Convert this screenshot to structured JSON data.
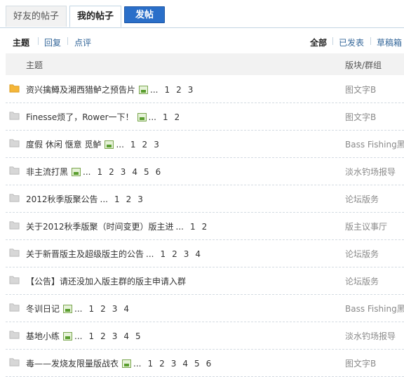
{
  "tabs": {
    "friends_label": "好友的帖子",
    "mine_label": "我的帖子",
    "post_label": "发帖"
  },
  "filters": {
    "subject": "主题",
    "reply": "回复",
    "comment": "点评",
    "all": "全部",
    "published": "已发表",
    "drafts": "草稿箱"
  },
  "table": {
    "header_subject": "主题",
    "header_forum": "版块/群组",
    "ellipsis": "...",
    "rows": [
      {
        "title": "资兴擒鳟及湘西猎鲈之预告片",
        "has_image": true,
        "pages": [
          "1",
          "2",
          "3"
        ],
        "forum": "图文字B",
        "icon": "folder-hot-icon"
      },
      {
        "title": "Finesse烦了，Rower一下！",
        "has_image": true,
        "pages": [
          "1",
          "2"
        ],
        "forum": "图文字B",
        "icon": "folder-icon"
      },
      {
        "title": "度假 休闲 惬意 觅鲈",
        "has_image": true,
        "pages": [
          "1",
          "2",
          "3"
        ],
        "forum": "Bass Fishing黑鲈",
        "icon": "folder-icon"
      },
      {
        "title": "非主流打黑",
        "has_image": true,
        "pages": [
          "1",
          "2",
          "3",
          "4",
          "5",
          "6"
        ],
        "forum": "淡水钓场报导",
        "icon": "folder-icon"
      },
      {
        "title": "2012秋季版聚公告",
        "has_image": false,
        "pages": [
          "1",
          "2",
          "3"
        ],
        "forum": "论坛版务",
        "icon": "folder-icon"
      },
      {
        "title": "关于2012秋季版聚（时间变更）版主进",
        "has_image": false,
        "pages": [
          "1",
          "2"
        ],
        "forum": "版主议事厅",
        "icon": "folder-icon"
      },
      {
        "title": "关于新晋版主及超级版主的公告",
        "has_image": false,
        "pages": [
          "1",
          "2",
          "3",
          "4"
        ],
        "forum": "论坛版务",
        "icon": "folder-icon"
      },
      {
        "title": "【公告】请还没加入版主群的版主申请入群",
        "has_image": false,
        "pages": [],
        "forum": "论坛版务",
        "icon": "folder-icon"
      },
      {
        "title": "冬训日记",
        "has_image": true,
        "pages": [
          "1",
          "2",
          "3",
          "4"
        ],
        "forum": "Bass Fishing黑鲈",
        "icon": "folder-icon"
      },
      {
        "title": "基地小练",
        "has_image": true,
        "pages": [
          "1",
          "2",
          "3",
          "4",
          "5"
        ],
        "forum": "淡水钓场报导",
        "icon": "folder-icon"
      },
      {
        "title": "毒——发烧友限量版战衣",
        "has_image": true,
        "pages": [
          "1",
          "2",
          "3",
          "4",
          "5",
          "6"
        ],
        "forum": "图文字B",
        "icon": "folder-icon"
      }
    ]
  },
  "colors": {
    "link": "#336699",
    "post_button": "#2a6fc9",
    "folder_hot": "#f5b638",
    "folder": "#d7d7d7"
  }
}
